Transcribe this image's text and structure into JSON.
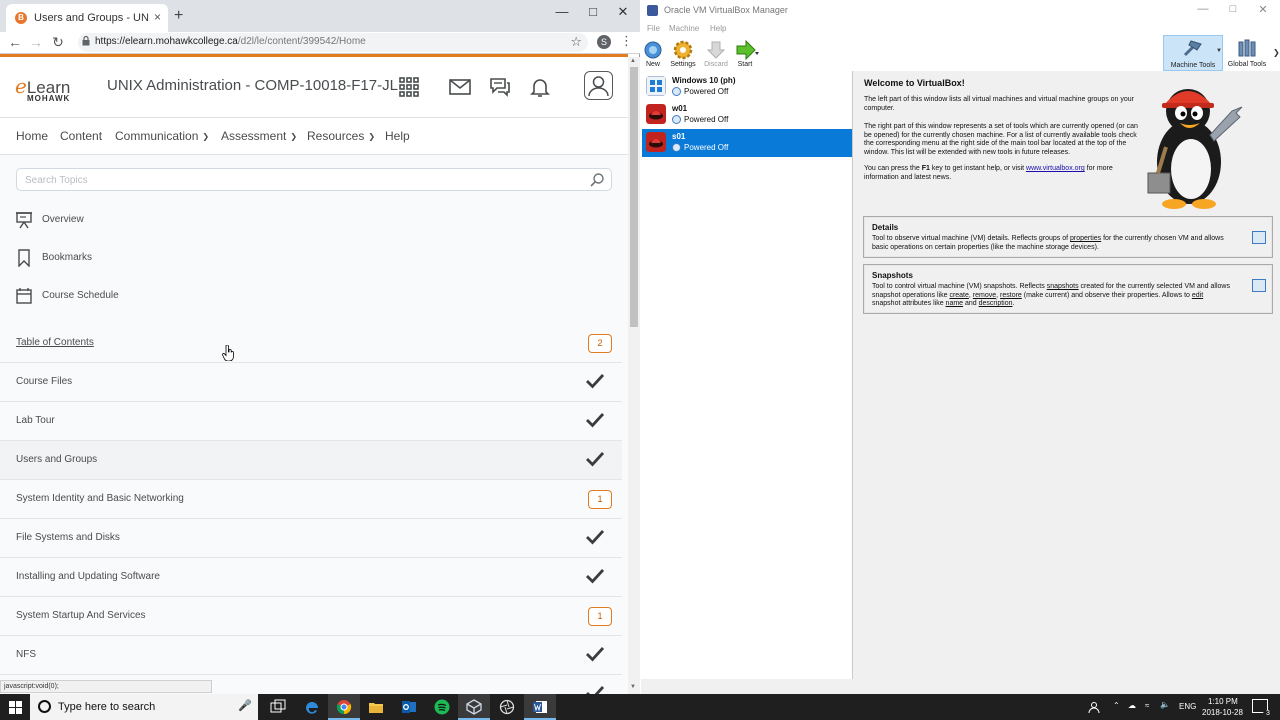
{
  "chrome": {
    "tab_title": "Users and Groups - UNIX Admin",
    "tab_close": "×",
    "new_tab": "+",
    "url_host": "https://elearn.mohawkcollege.ca",
    "url_path": "/d2l/le/content/399542/Home",
    "profile_initial": "S",
    "status_tip": "javascript:void(0);"
  },
  "header": {
    "logo_e": "e",
    "logo_learn": "Learn",
    "logo_sub": "MOHAWK",
    "course_title": "UNIX Administration - COMP-10018-F17-JL"
  },
  "topnav": [
    {
      "label": "Home",
      "dropdown": false
    },
    {
      "label": "Content",
      "dropdown": false
    },
    {
      "label": "Communication",
      "dropdown": true
    },
    {
      "label": "Assessment",
      "dropdown": true
    },
    {
      "label": "Resources",
      "dropdown": true
    },
    {
      "label": "Help",
      "dropdown": false
    }
  ],
  "search": {
    "placeholder": "Search Topics"
  },
  "side_links": [
    {
      "label": "Overview",
      "icon": "presentation-icon"
    },
    {
      "label": "Bookmarks",
      "icon": "bookmark-icon"
    },
    {
      "label": "Course Schedule",
      "icon": "calendar-icon"
    }
  ],
  "toc": [
    {
      "label": "Table of Contents",
      "status": "badge",
      "badge": "2",
      "link": true
    },
    {
      "label": "Course Files",
      "status": "check"
    },
    {
      "label": "Lab Tour",
      "status": "check"
    },
    {
      "label": "Users and Groups",
      "status": "check",
      "highlight": true
    },
    {
      "label": "System Identity and Basic Networking",
      "status": "badge",
      "badge": "1"
    },
    {
      "label": "File Systems and Disks",
      "status": "check"
    },
    {
      "label": "Installing and Updating Software",
      "status": "check"
    },
    {
      "label": "System Startup And Services",
      "status": "badge",
      "badge": "1"
    },
    {
      "label": "NFS",
      "status": "check"
    }
  ],
  "vbox": {
    "title": "Oracle VM VirtualBox Manager",
    "menu": [
      "File",
      "Machine",
      "Help"
    ],
    "toolbar": [
      {
        "label": "New",
        "enabled": true
      },
      {
        "label": "Settings",
        "enabled": true
      },
      {
        "label": "Discard",
        "enabled": false
      },
      {
        "label": "Start",
        "enabled": true
      }
    ],
    "machine_tools": "Machine Tools",
    "global_tools": "Global Tools",
    "vms": [
      {
        "name": "Windows 10 (ph)",
        "state": "Powered Off",
        "os": "windows",
        "selected": false
      },
      {
        "name": "w01",
        "state": "Powered Off",
        "os": "redhat",
        "selected": false
      },
      {
        "name": "s01",
        "state": "Powered Off",
        "os": "redhat",
        "selected": true
      }
    ],
    "welcome_title": "Welcome to VirtualBox!",
    "welcome_p1": "The left part of this window lists all virtual machines and virtual machine groups on your computer.",
    "welcome_p2": "The right part of this window represents a set of tools which are currently opened (or can be opened) for the currently chosen machine. For a list of currently available tools check the corresponding menu at the right side of the main tool bar located at the top of the window. This list will be extended with new tools in future releases.",
    "welcome_p3_a": "You can press the ",
    "welcome_p3_key": "F1",
    "welcome_p3_b": " key to get instant help, or visit ",
    "welcome_link": "www.virtualbox.org",
    "welcome_p3_c": " for more information and latest news.",
    "details_title": "Details",
    "details_desc_a": "Tool to observe virtual machine (VM) details. Reflects groups of ",
    "details_desc_link": "properties",
    "details_desc_b": " for the currently chosen VM and allows basic operations on certain properties (like the machine storage devices).",
    "snapshots_title": "Snapshots",
    "snapshots_desc_a": "Tool to control virtual machine (VM) snapshots. Reflects ",
    "snapshots_l1": "snapshots",
    "snapshots_desc_b": " created for the currently selected VM and allows snapshot operations like ",
    "snapshots_l2": "create",
    "snapshots_sep1": ", ",
    "snapshots_l3": "remove",
    "snapshots_sep2": ", ",
    "snapshots_l4": "restore",
    "snapshots_desc_c": " (make current) and observe their properties. Allows to ",
    "snapshots_l5": "edit",
    "snapshots_desc_d": " snapshot attributes like ",
    "snapshots_l6": "name",
    "snapshots_desc_e": " and ",
    "snapshots_l7": "description",
    "snapshots_desc_f": "."
  },
  "taskbar": {
    "search_placeholder": "Type here to search",
    "lang": "ENG",
    "time": "1:10 PM",
    "date": "2018-10-28",
    "notifications": "3"
  },
  "colors": {
    "brand_orange": "#e27c20",
    "vbox_selection": "#0a7ad8",
    "taskbar": "#1f1f1f"
  }
}
